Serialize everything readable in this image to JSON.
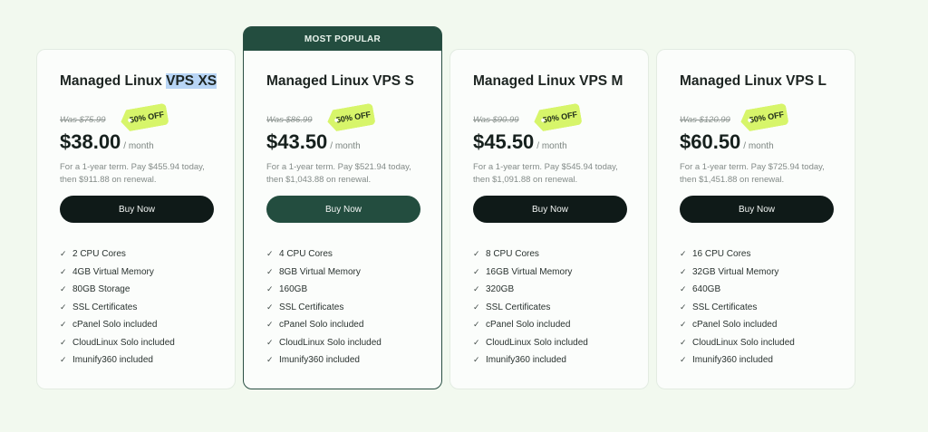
{
  "featured_label": "MOST POPULAR",
  "check_icon": "check-icon",
  "colors": {
    "background": "#f2f9ef",
    "featured_accent": "#234d3f",
    "button_dark": "#0f1a18",
    "tag_lime": "#d7f56a",
    "selection_highlight": "#b8d5f5"
  },
  "plans": [
    {
      "title_prefix": "Managed Linux ",
      "title_highlight": "VPS XS",
      "was": "Was $75.99",
      "discount": "50% OFF",
      "price": "$38.00",
      "per": "/ month",
      "term_line1": "For a 1-year term. Pay $455.94 today,",
      "term_line2": "then $911.88 on renewal.",
      "button": "Buy Now",
      "features": [
        "2 CPU Cores",
        "4GB Virtual Memory",
        "80GB Storage",
        "SSL Certificates",
        "cPanel Solo included",
        "CloudLinux Solo included",
        "Imunify360 included"
      ]
    },
    {
      "title_prefix": "Managed Linux VPS S",
      "title_highlight": "",
      "was": "Was $86.99",
      "discount": "50% OFF",
      "price": "$43.50",
      "per": "/ month",
      "term_line1": "For a 1-year term. Pay $521.94 today,",
      "term_line2": "then $1,043.88 on renewal.",
      "button": "Buy Now",
      "features": [
        "4 CPU Cores",
        "8GB Virtual Memory",
        "160GB",
        "SSL Certificates",
        "cPanel Solo included",
        "CloudLinux Solo included",
        "Imunify360 included"
      ]
    },
    {
      "title_prefix": "Managed Linux VPS M",
      "title_highlight": "",
      "was": "Was $90.99",
      "discount": "50% OFF",
      "price": "$45.50",
      "per": "/ month",
      "term_line1": "For a 1-year term. Pay $545.94 today,",
      "term_line2": "then $1,091.88 on renewal.",
      "button": "Buy Now",
      "features": [
        "8 CPU Cores",
        "16GB Virtual Memory",
        "320GB",
        "SSL Certificates",
        "cPanel Solo included",
        "CloudLinux Solo included",
        "Imunify360 included"
      ]
    },
    {
      "title_prefix": "Managed Linux VPS L",
      "title_highlight": "",
      "was": "Was $120.99",
      "discount": "50% OFF",
      "price": "$60.50",
      "per": "/ month",
      "term_line1": "For a 1-year term. Pay $725.94 today,",
      "term_line2": "then $1,451.88 on renewal.",
      "button": "Buy Now",
      "features": [
        "16 CPU Cores",
        "32GB Virtual Memory",
        "640GB",
        "SSL Certificates",
        "cPanel Solo included",
        "CloudLinux Solo included",
        "Imunify360 included"
      ]
    }
  ]
}
